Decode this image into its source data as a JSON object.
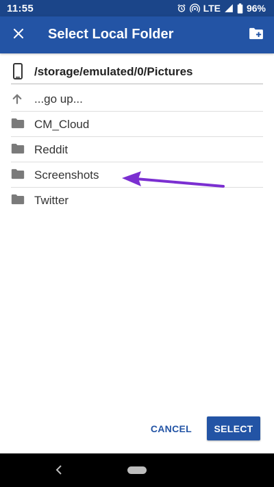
{
  "status_bar": {
    "time": "11:55",
    "network": "LTE",
    "battery": "96%",
    "icons": [
      "alarm-icon",
      "hotspot-icon",
      "signal-icon",
      "battery-icon"
    ]
  },
  "app_bar": {
    "title": "Select Local Folder",
    "close_icon": "close-icon",
    "new_folder_icon": "new-folder-icon"
  },
  "path": {
    "text": "/storage/emulated/0/Pictures",
    "icon": "phone-icon"
  },
  "folders": [
    {
      "label": "...go up...",
      "icon": "arrow-up-icon"
    },
    {
      "label": "CM_Cloud",
      "icon": "folder-icon"
    },
    {
      "label": "Reddit",
      "icon": "folder-icon"
    },
    {
      "label": "Screenshots",
      "icon": "folder-icon"
    },
    {
      "label": "Twitter",
      "icon": "folder-icon"
    }
  ],
  "actions": {
    "cancel_label": "CANCEL",
    "select_label": "SELECT"
  },
  "colors": {
    "status_bar": "#1b4589",
    "app_bar": "#2354a5",
    "accent": "#2354a5",
    "annotation_arrow": "#7b2fd1",
    "folder_icon": "#7a7a7a"
  }
}
